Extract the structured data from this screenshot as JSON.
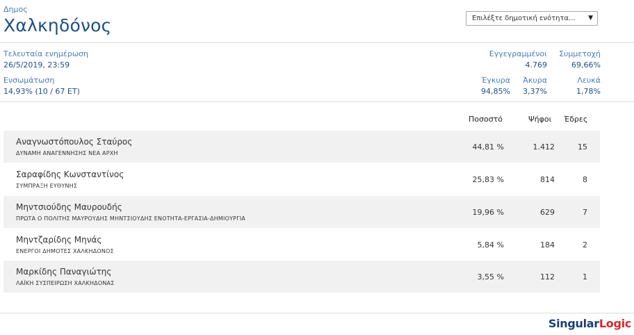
{
  "header": {
    "kind": "Δημος",
    "title": "Χαλκηδόνος",
    "select_placeholder": "Επιλέξτε δημοτική ενότητα..."
  },
  "stats": {
    "last_update_label": "Τελευταία ενημέρωση",
    "last_update_value": "26/5/2019, 23:59",
    "integration_label": "Ενσωμάτωση",
    "integration_value": "14,93% (10 / 67 ΕΤ)",
    "registered_label": "Εγγεγραμμένοι",
    "registered_value": "4.769",
    "turnout_label": "Συμμετοχή",
    "turnout_value": "69,66%",
    "valid_label": "Έγκυρα",
    "valid_value": "94,85%",
    "invalid_label": "Άκυρα",
    "invalid_value": "3,37%",
    "blank_label": "Λευκά",
    "blank_value": "1,78%"
  },
  "table": {
    "headers": {
      "percent": "Ποσοστό",
      "votes": "Ψήφοι",
      "seats": "Έδρες"
    },
    "rows": [
      {
        "candidate": "Αναγνωστόπουλος Σταύρος",
        "party": "ΔΥΝΑΜΗ ΑΝΑΓΕΝΝΗΣΗΣ  ΝΕΑ ΑΡΧΗ",
        "percent": "44,81 %",
        "votes": "1.412",
        "seats": "15"
      },
      {
        "candidate": "Σαραφίδης Κωνσταντίνος",
        "party": "ΣΥΜΠΡΑΞΗ ΕΥΘΥΝΗΣ",
        "percent": "25,83 %",
        "votes": "814",
        "seats": "8"
      },
      {
        "candidate": "Μηντσιούδης Μαυρουδής",
        "party": "ΠΡΩΤΑ Ο ΠΟΛΙΤΗΣ ΜΑΥΡΟΥΔΗΣ ΜΗΝΤΣΙΟΥΔΗΣ ΕΝΟΤΗΤΑ-ΕΡΓΑΣΙΑ-ΔΗΜΙΟΥΡΓΙΑ",
        "percent": "19,96 %",
        "votes": "629",
        "seats": "7"
      },
      {
        "candidate": "Μηντζαρίδης Μηνάς",
        "party": "ΕΝΕΡΓΟΙ ΔΗΜΟΤΕΣ ΧΑΛΚΗΔΟΝΟΣ",
        "percent": "5,84 %",
        "votes": "184",
        "seats": "2"
      },
      {
        "candidate": "Μαρκίδης Παναγιώτης",
        "party": "ΛΑΪΚΗ ΣΥΣΠΕΙΡΩΣΗ ΧΑΛΚΗΔΟΝΑΣ",
        "percent": "3,55 %",
        "votes": "112",
        "seats": "1"
      }
    ]
  },
  "footer": {
    "logo_part1": "Singular",
    "logo_part2": "Logic"
  },
  "colors": {
    "title": "#1f4e86",
    "label": "#4a7cb5",
    "row_bg": "#f1f1f1",
    "logo_accent": "#d6282b"
  }
}
